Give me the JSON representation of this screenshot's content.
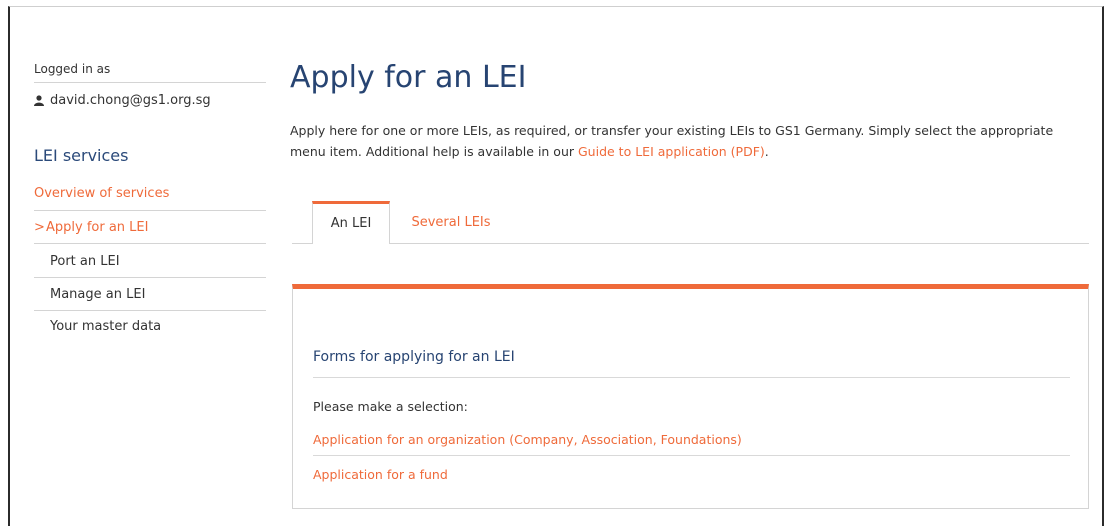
{
  "sidebar": {
    "logged_in_label": "Logged in as",
    "user_email": "david.chong@gs1.org.sg",
    "services_heading": "LEI services",
    "items": [
      {
        "label": "Overview of services",
        "state": "link"
      },
      {
        "label": "Apply for an LEI",
        "state": "current"
      },
      {
        "label": "Port an LEI",
        "state": "sub"
      },
      {
        "label": "Manage an LEI",
        "state": "sub"
      },
      {
        "label": "Your master data",
        "state": "sub"
      }
    ],
    "current_marker": ">",
    "user_icon": "user-icon"
  },
  "main": {
    "title": "Apply for an LEI",
    "intro_text": "Apply here for one or more LEIs, as required, or transfer your existing LEIs to GS1 Germany. Simply select the appropriate menu item. Additional help is available in our ",
    "intro_link": "Guide to LEI application (PDF)",
    "intro_end": ".",
    "tabs": [
      {
        "label": "An LEI",
        "active": true
      },
      {
        "label": "Several LEIs",
        "active": false
      }
    ],
    "panel": {
      "title": "Forms for applying for an LEI",
      "prompt": "Please make a selection:",
      "links": [
        "Application for an organization (Company, Association, Foundations)",
        "Application for a fund"
      ]
    }
  },
  "colors": {
    "accent": "#ef6a3a",
    "heading": "#274472",
    "border": "#d4d4d4"
  }
}
